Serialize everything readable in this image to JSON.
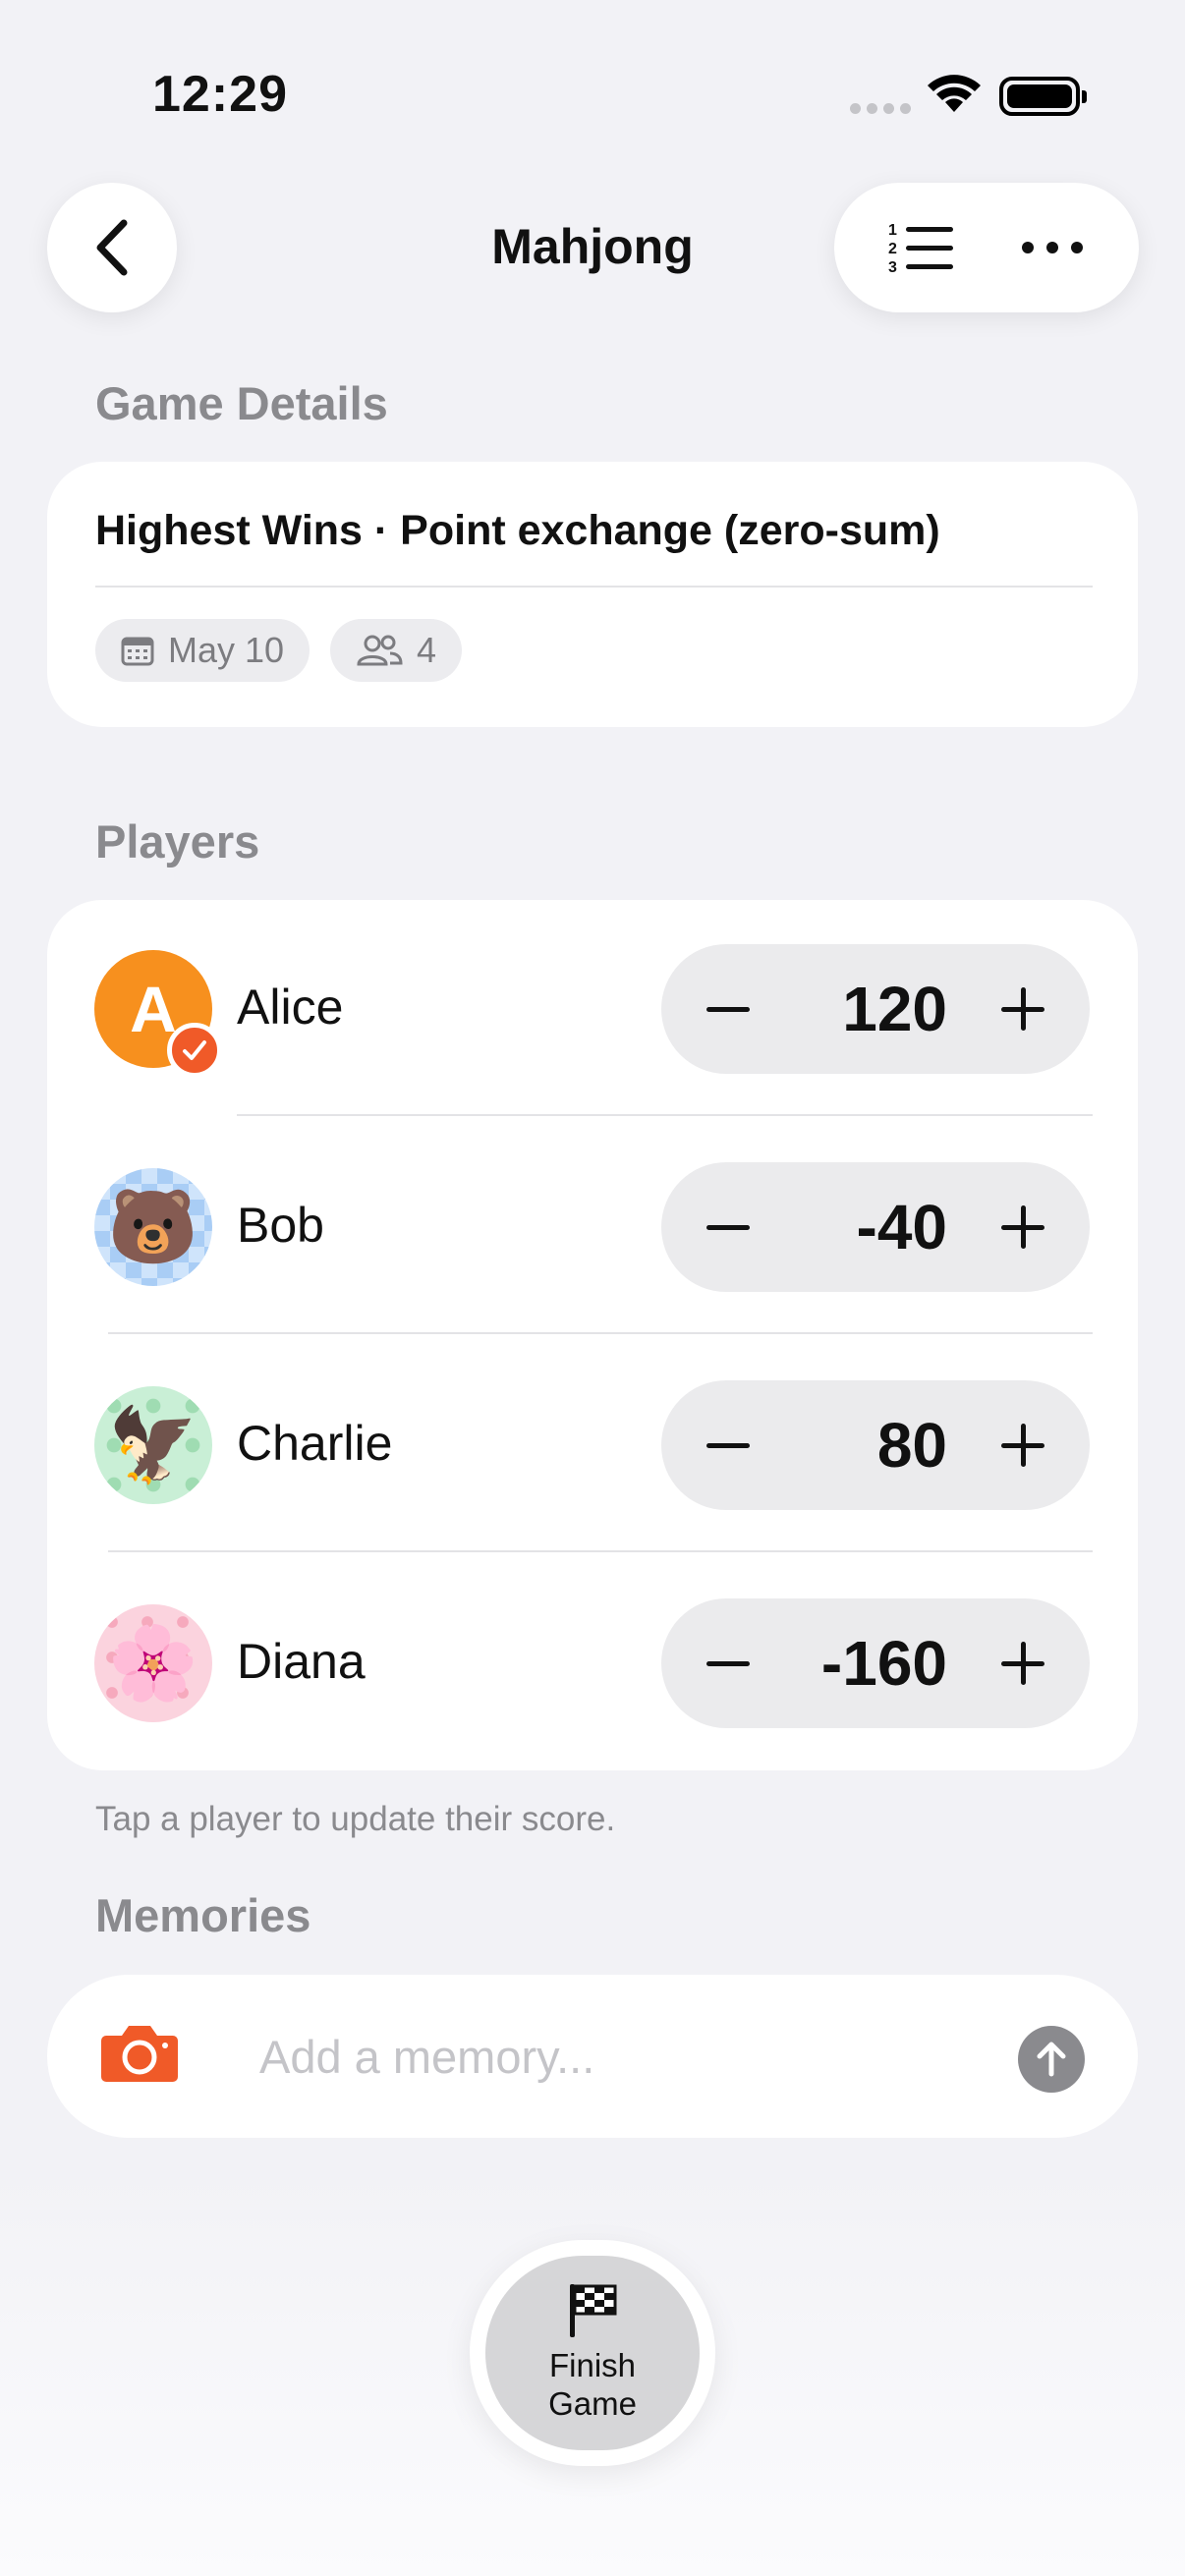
{
  "status_bar": {
    "time": "12:29"
  },
  "nav": {
    "title": "Mahjong"
  },
  "game_details": {
    "section_label": "Game Details",
    "summary": "Highest Wins · Point exchange (zero-sum)",
    "date": "May 10",
    "player_count": "4"
  },
  "players": {
    "section_label": "Players",
    "list": [
      {
        "name": "Alice",
        "score": "120",
        "avatar_letter": "A"
      },
      {
        "name": "Bob",
        "score": "-40",
        "avatar_emoji": "🐻"
      },
      {
        "name": "Charlie",
        "score": "80",
        "avatar_emoji": "🦅"
      },
      {
        "name": "Diana",
        "score": "-160",
        "avatar_emoji": "🌸"
      }
    ],
    "footnote": "Tap a player to update their score."
  },
  "memories": {
    "section_label": "Memories",
    "placeholder": "Add a memory..."
  },
  "finish": {
    "label": "Finish Game"
  },
  "colors": {
    "background": "#f2f2f6",
    "alice_avatar": "#f7901e",
    "accent_orange": "#f05a28",
    "bob_avatar_bg": "#a9cdf5",
    "charlie_avatar_bg": "#c9efd6",
    "diana_avatar_bg": "#fbd3de"
  }
}
